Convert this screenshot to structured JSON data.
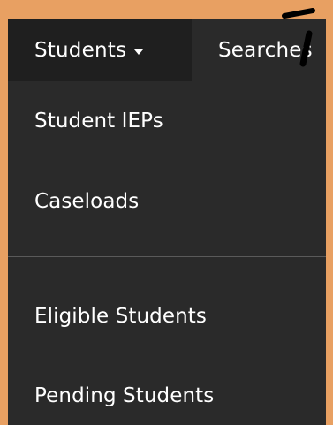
{
  "navbar": {
    "active_tab": "Students",
    "second_tab": "Searches"
  },
  "dropdown": {
    "items": [
      "Student IEPs",
      "Caseloads",
      "Eligible Students",
      "Pending Students"
    ]
  },
  "colors": {
    "background": "#e8a062",
    "panel": "#2a2a2a",
    "active_tab": "#1f1f1f",
    "text": "#ffffff",
    "divider": "#5a5a5a"
  },
  "icons": {
    "caret": "caret-down-icon",
    "mark": "pen-stroke-icon"
  }
}
